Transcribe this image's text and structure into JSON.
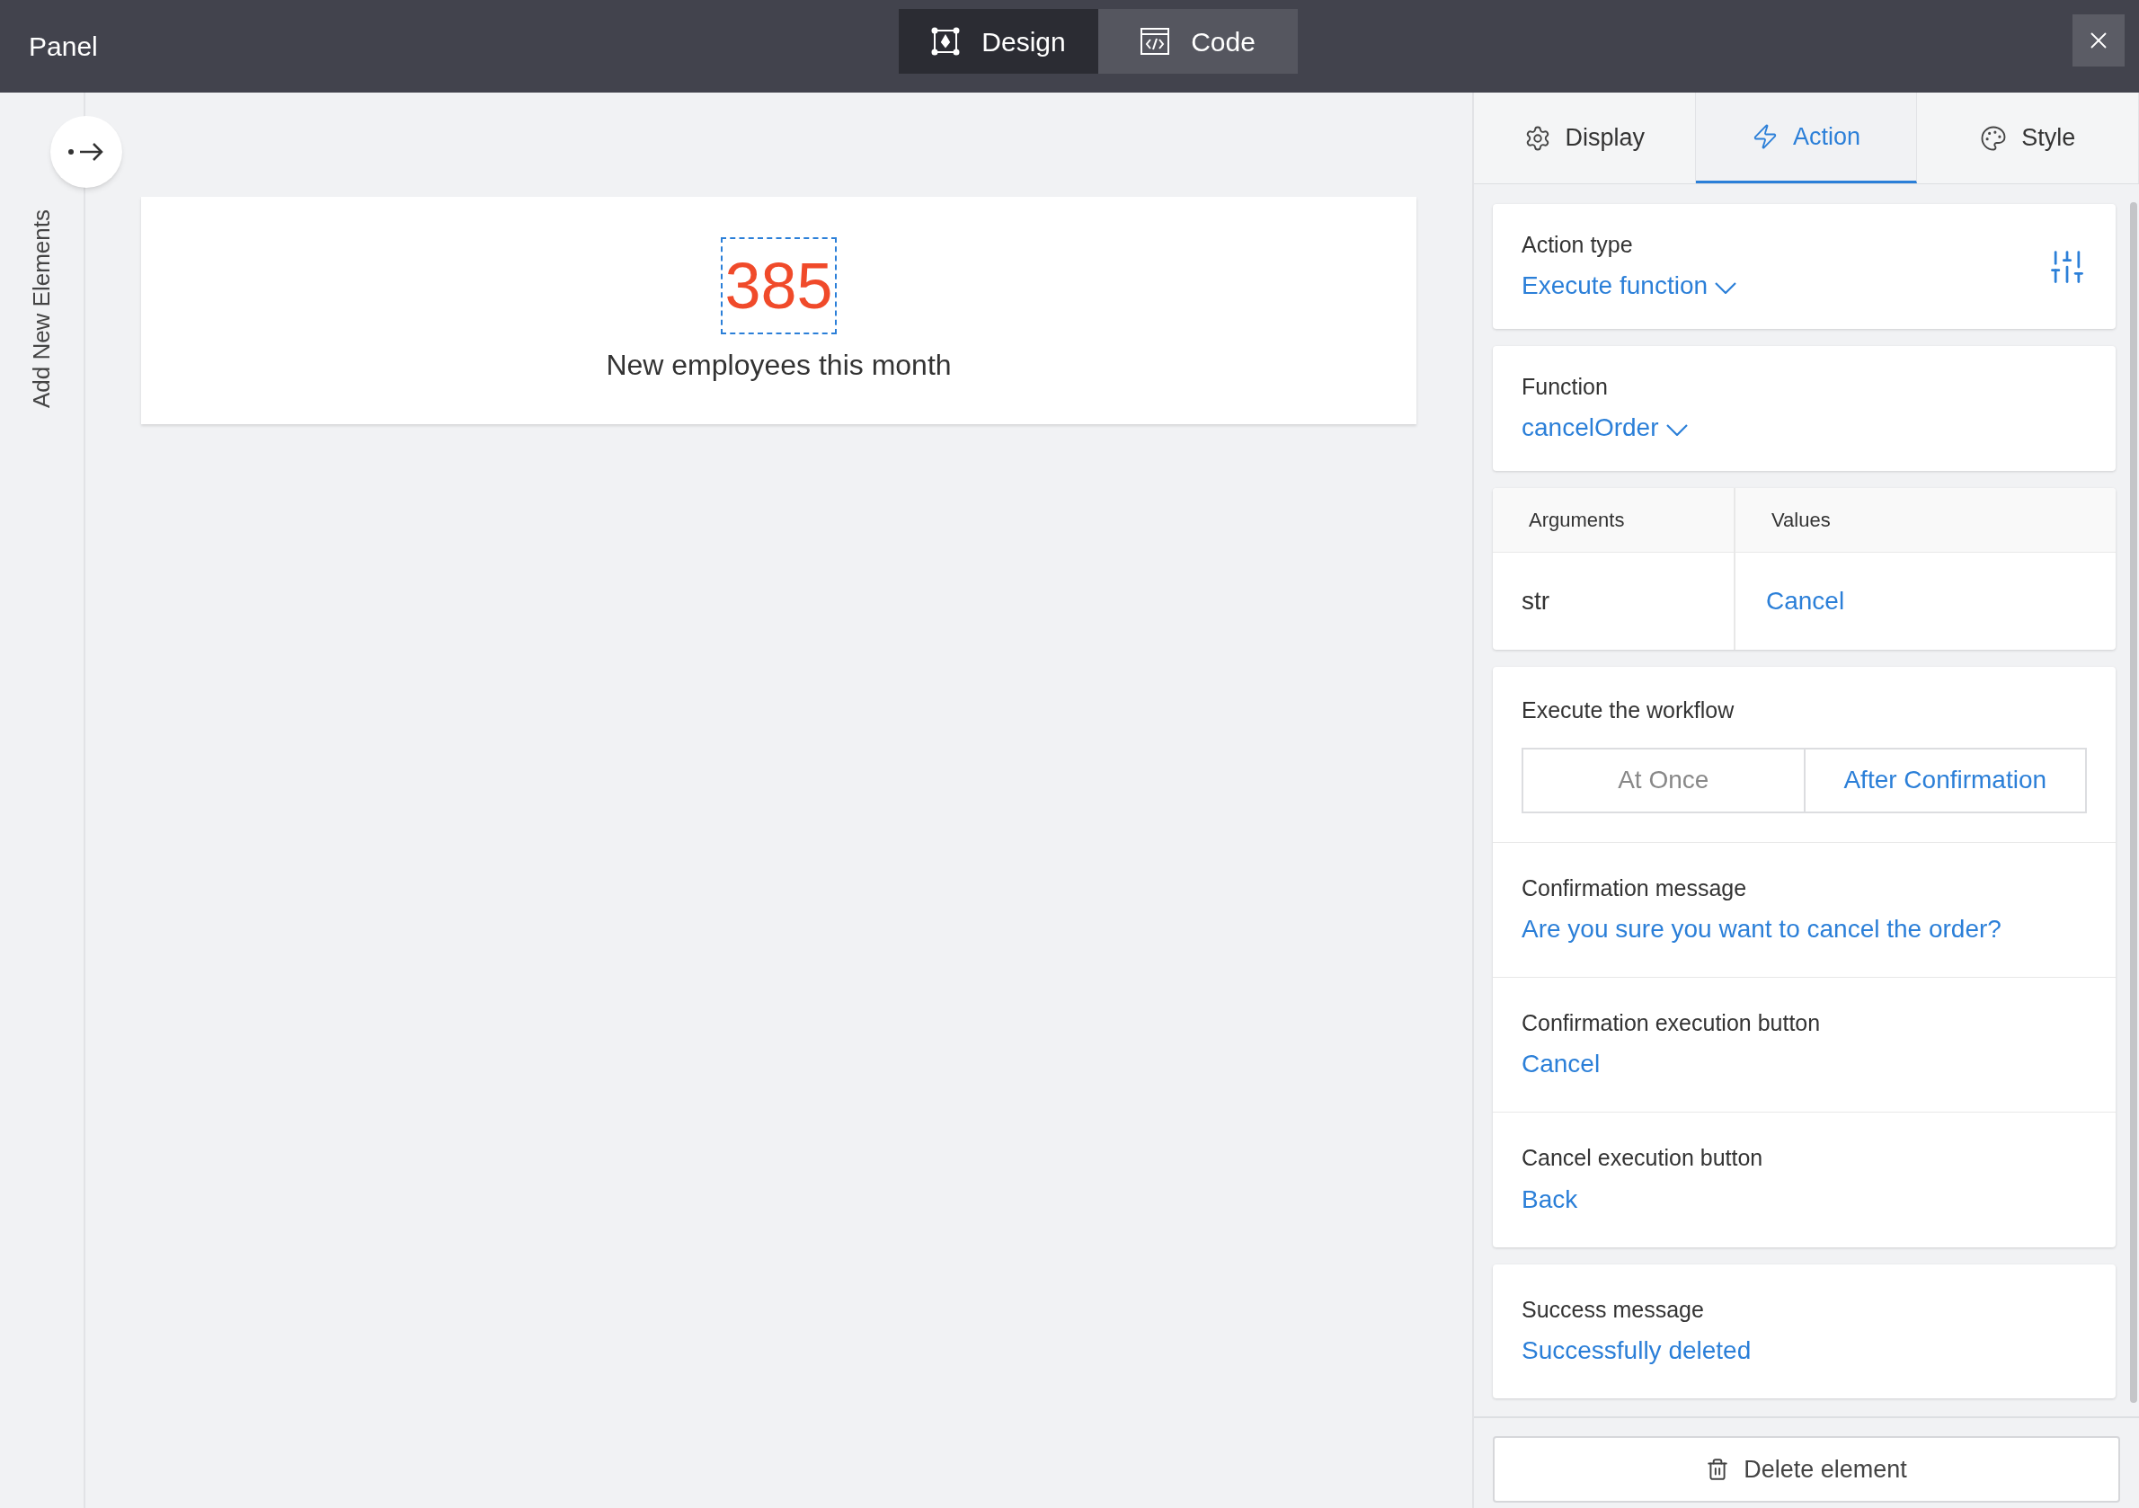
{
  "title": "Panel",
  "mode_tabs": [
    {
      "label": "Design",
      "kind": "design",
      "selected": true
    },
    {
      "label": "Code",
      "kind": "code",
      "selected": false
    }
  ],
  "sidebar": {
    "label": "Add New Elements"
  },
  "widget": {
    "value": "385",
    "caption": "New employees this month"
  },
  "panel_tabs": [
    {
      "label": "Display",
      "kind": "gear",
      "selected": false
    },
    {
      "label": "Action",
      "kind": "bolt",
      "selected": true
    },
    {
      "label": "Style",
      "kind": "palette",
      "selected": false
    }
  ],
  "action_type": {
    "label": "Action type",
    "value": "Execute function"
  },
  "function": {
    "label": "Function",
    "value": "cancelOrder"
  },
  "arguments": {
    "columns": [
      "Arguments",
      "Values"
    ],
    "rows": [
      [
        "str",
        "Cancel"
      ]
    ]
  },
  "workflow": {
    "label": "Execute the workflow",
    "options": [
      {
        "label": "At Once",
        "selected": false
      },
      {
        "label": "After Confirmation",
        "selected": true
      }
    ]
  },
  "confirm_fields": [
    {
      "label": "Confirmation message",
      "value": "Are you sure you want to cancel the order?"
    },
    {
      "label": "Confirmation execution button",
      "value": "Cancel"
    },
    {
      "label": "Cancel execution button",
      "value": "Back"
    }
  ],
  "success": {
    "label": "Success message",
    "value": "Successfully deleted"
  },
  "delete_button": "Delete element"
}
